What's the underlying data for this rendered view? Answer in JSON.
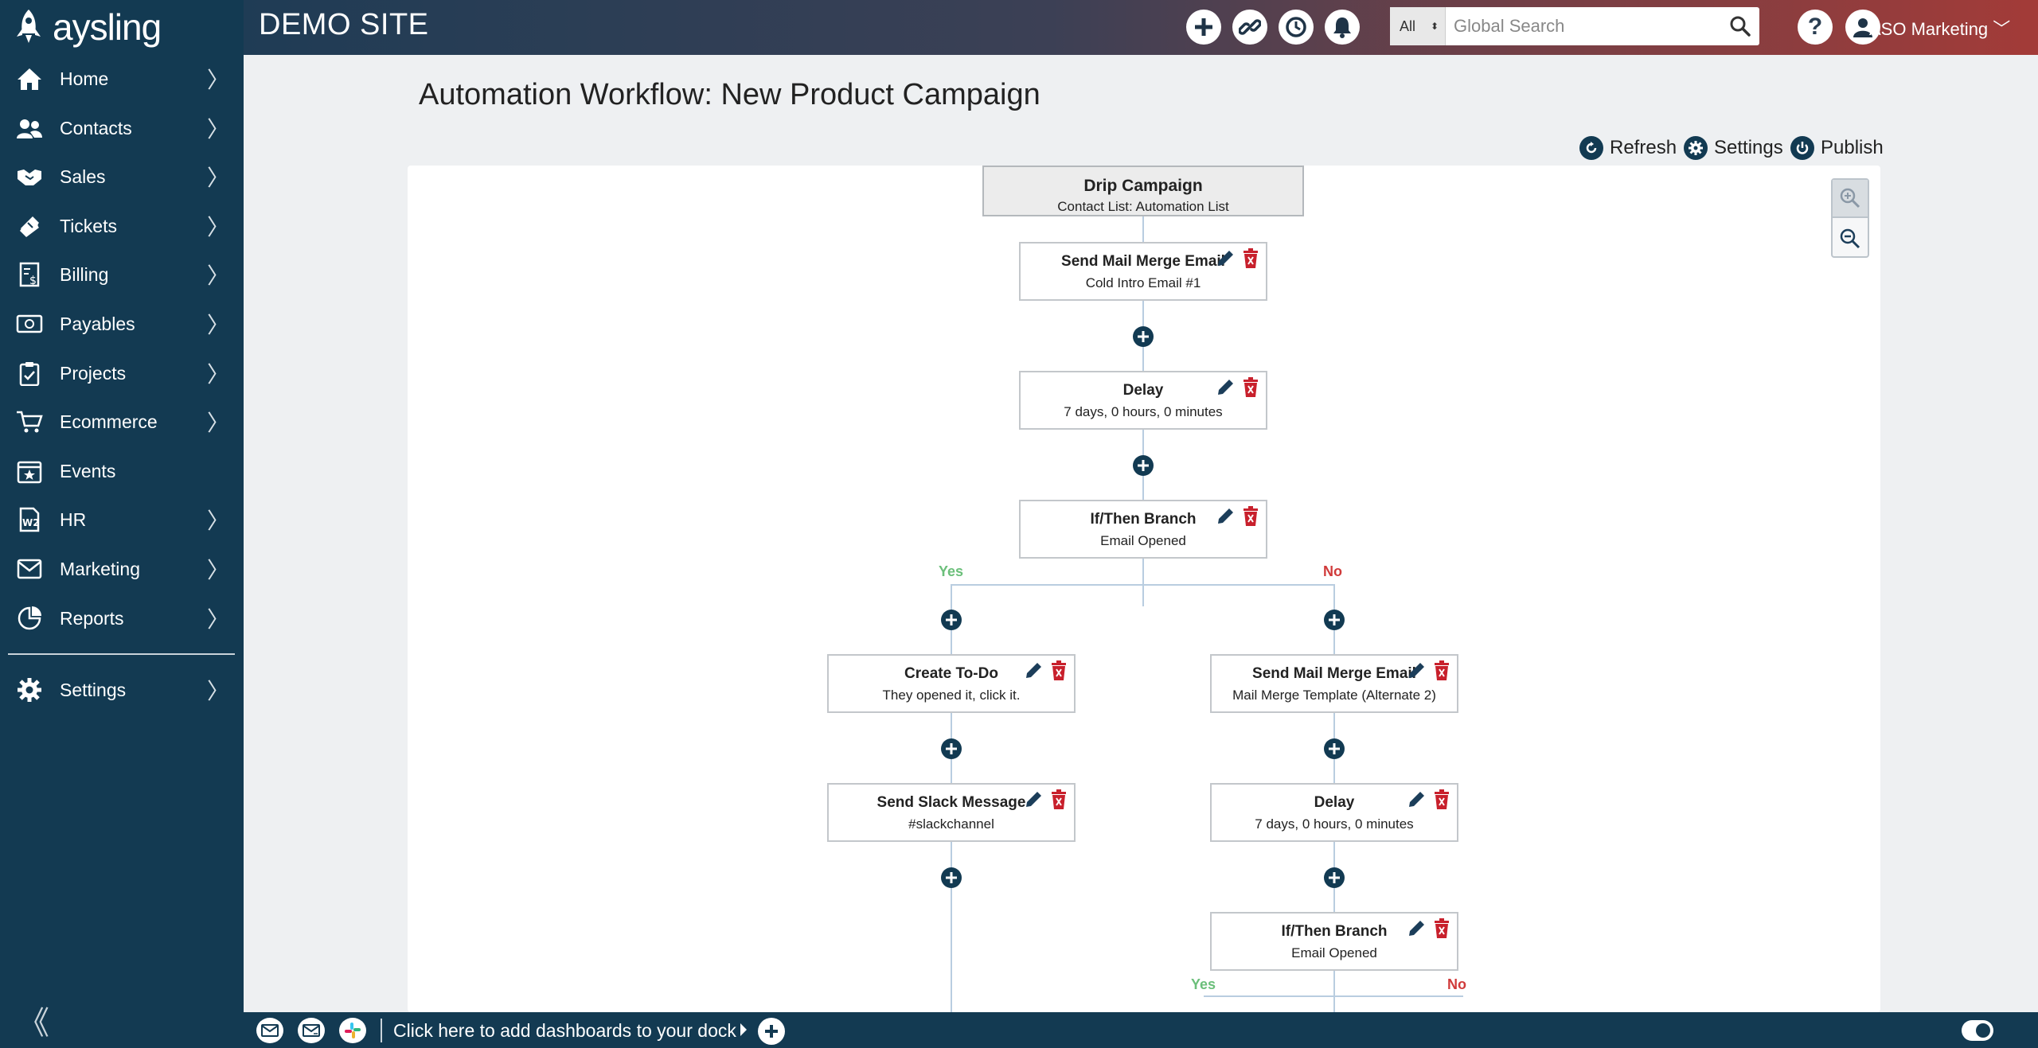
{
  "app": {
    "brand": "aysling",
    "site_title": "DEMO SITE"
  },
  "sidebar": {
    "items": [
      {
        "label": "Home",
        "icon": "home-icon",
        "chevron": "〉"
      },
      {
        "label": "Contacts",
        "icon": "contacts-icon",
        "chevron": "〉"
      },
      {
        "label": "Sales",
        "icon": "handshake-icon",
        "chevron": "〉"
      },
      {
        "label": "Tickets",
        "icon": "ticket-icon",
        "chevron": "〉"
      },
      {
        "label": "Billing",
        "icon": "billing-icon",
        "chevron": "〉"
      },
      {
        "label": "Payables",
        "icon": "payables-icon",
        "chevron": "〉"
      },
      {
        "label": "Projects",
        "icon": "clipboard-icon",
        "chevron": "〉"
      },
      {
        "label": "Ecommerce",
        "icon": "cart-icon",
        "chevron": "〉"
      },
      {
        "label": "Events",
        "icon": "calendar-icon",
        "chevron": ""
      },
      {
        "label": "HR",
        "icon": "w2-icon",
        "chevron": "〉"
      },
      {
        "label": "Marketing",
        "icon": "mail-icon",
        "chevron": "〉"
      },
      {
        "label": "Reports",
        "icon": "reports-icon",
        "chevron": "〉"
      },
      {
        "label": "Settings",
        "icon": "gear-icon",
        "chevron": "〉"
      }
    ],
    "collapse_glyph": "《"
  },
  "topbar": {
    "search_scope": "All",
    "search_placeholder": "Global Search",
    "help_glyph": "?",
    "user_name": "ASO Marketing ﹀"
  },
  "page": {
    "title": "Automation Workflow: New Product Campaign",
    "actions": {
      "refresh": "Refresh",
      "settings": "Settings",
      "publish": "Publish"
    }
  },
  "workflow": {
    "trigger": {
      "title": "Drip Campaign",
      "subtitle": "Contact List: Automation List"
    },
    "nodes": [
      {
        "title": "Send Mail Merge Email",
        "subtitle": "Cold Intro Email #1"
      },
      {
        "title": "Delay",
        "subtitle": "7 days, 0 hours, 0 minutes"
      },
      {
        "title": "If/Then Branch",
        "subtitle": "Email Opened"
      },
      {
        "title": "Create To-Do",
        "subtitle": "They opened it, click it."
      },
      {
        "title": "Send Slack Message",
        "subtitle": "#slackchannel"
      },
      {
        "title": "Send Mail Merge Email",
        "subtitle": "Mail Merge Template (Alternate 2)"
      },
      {
        "title": "Delay",
        "subtitle": "7 days, 0 hours, 0 minutes"
      },
      {
        "title": "If/Then Branch",
        "subtitle": "Email Opened"
      }
    ],
    "branch_labels": {
      "yes": "Yes",
      "no": "No"
    }
  },
  "dock": {
    "text": "Click here to add dashboards to your dock"
  },
  "colors": {
    "sidebar": "#133a52",
    "yes": "#6bbf7a",
    "no": "#d03a3a",
    "delete": "#c8202c",
    "connector": "#b9cde0"
  }
}
